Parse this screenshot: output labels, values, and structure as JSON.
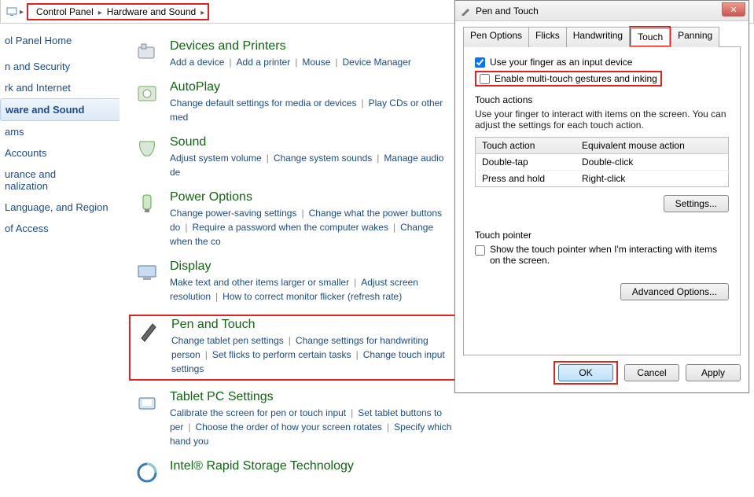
{
  "breadcrumb": {
    "items": [
      "Control Panel",
      "Hardware and Sound"
    ]
  },
  "sidebar": {
    "home": "ol Panel Home",
    "items": [
      "n and Security",
      "rk and Internet",
      "ware and Sound",
      "ams",
      "Accounts",
      "urance and\nnalization",
      "Language, and Region",
      "of Access"
    ],
    "active_index": 2
  },
  "categories": [
    {
      "title": "Devices and Printers",
      "links": [
        "Add a device",
        "Add a printer",
        "Mouse",
        "Device Manager"
      ]
    },
    {
      "title": "AutoPlay",
      "links": [
        "Change default settings for media or devices",
        "Play CDs or other med"
      ]
    },
    {
      "title": "Sound",
      "links": [
        "Adjust system volume",
        "Change system sounds",
        "Manage audio de"
      ]
    },
    {
      "title": "Power Options",
      "links": [
        "Change power-saving settings",
        "Change what the power buttons do",
        "Require a password when the computer wakes",
        "Change when the co"
      ]
    },
    {
      "title": "Display",
      "links": [
        "Make text and other items larger or smaller",
        "Adjust screen resolution",
        "How to correct monitor flicker (refresh rate)"
      ]
    },
    {
      "title": "Pen and Touch",
      "links": [
        "Change tablet pen settings",
        "Change settings for handwriting person",
        "Set flicks to perform certain tasks",
        "Change touch input settings"
      ]
    },
    {
      "title": "Tablet PC Settings",
      "links": [
        "Calibrate the screen for pen or touch input",
        "Set tablet buttons to per",
        "Choose the order of how your screen rotates",
        "Specify which hand you"
      ]
    },
    {
      "title": "Intel® Rapid Storage Technology",
      "links": []
    }
  ],
  "dialog": {
    "title": "Pen and Touch",
    "tabs": [
      "Pen Options",
      "Flicks",
      "Handwriting",
      "Touch",
      "Panning"
    ],
    "active_tab": 3,
    "cb1_label": "Use your finger as an input device",
    "cb1_checked": true,
    "cb2_label": "Enable multi-touch gestures and inking",
    "cb2_checked": false,
    "touch_actions": {
      "title": "Touch actions",
      "desc": "Use your finger to interact with items on the screen. You can adjust the settings for each touch action.",
      "col1": "Touch action",
      "col2": "Equivalent mouse action",
      "rows": [
        {
          "a": "Double-tap",
          "b": "Double-click"
        },
        {
          "a": "Press and hold",
          "b": "Right-click"
        }
      ],
      "settings_btn": "Settings..."
    },
    "touch_pointer": {
      "title": "Touch pointer",
      "cb_label": "Show the touch pointer when I'm interacting with items on the screen.",
      "cb_checked": false
    },
    "advanced_btn": "Advanced Options...",
    "footer": {
      "ok": "OK",
      "cancel": "Cancel",
      "apply": "Apply"
    }
  }
}
